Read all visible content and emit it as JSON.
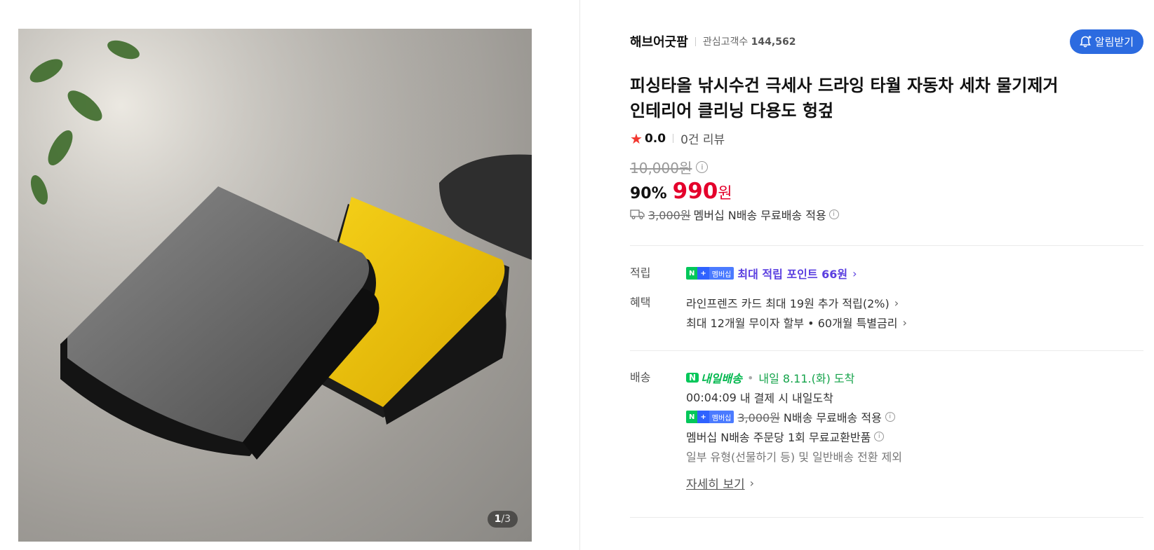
{
  "gallery": {
    "current_page": "1",
    "separator": "/",
    "total_pages": "3"
  },
  "store": {
    "name": "해브어굿팜",
    "interest_label": "관심고객수",
    "interest_count": "144,562",
    "alarm_button": "알림받기"
  },
  "product": {
    "title_line1": "피싱타올 낚시수건 극세사 드라잉 타월 자동차 세차 물기제거",
    "title_line2": "인테리어 클리닝 다용도 헝겊",
    "rating": "0.0",
    "review_count": "0건 리뷰",
    "original_price": "10,000원",
    "discount_rate": "90%",
    "sale_price": "990",
    "sale_currency": "원"
  },
  "shipping_summary": {
    "original_fee": "3,000원",
    "text": "멤버십 N배송 무료배송 적용"
  },
  "points": {
    "label": "적립",
    "badge_n": "N",
    "badge_plus": "+",
    "badge_membership": "멤버십",
    "link_text": "최대 적립 포인트 66원"
  },
  "benefits": {
    "label": "혜택",
    "line1": "라인프렌즈 카드 최대 19원 추가 적립(2%)",
    "line2": "최대 12개월 무이자 할부 • 60개월 특별금리"
  },
  "delivery": {
    "label": "배송",
    "badge_text": "내일배송",
    "badge_n": "N",
    "arrival": "내일 8.11.(화) 도착",
    "countdown": "00:04:09",
    "countdown_text": "내 결제 시 내일도착",
    "membership_fee_original": "3,000원",
    "membership_free_text": "N배송 무료배송 적용",
    "exchange_text": "멤버십 N배송 주문당 1회 무료교환반품",
    "exclusion_text": "일부 유형(선물하기 등) 및 일반배송 전환 제외",
    "detail_link": "자세히 보기"
  },
  "colors": {
    "accent_blue": "#2c6be0",
    "sale_red": "#e4002b",
    "naver_green": "#03c75a",
    "point_purple": "#5a3ee0"
  }
}
